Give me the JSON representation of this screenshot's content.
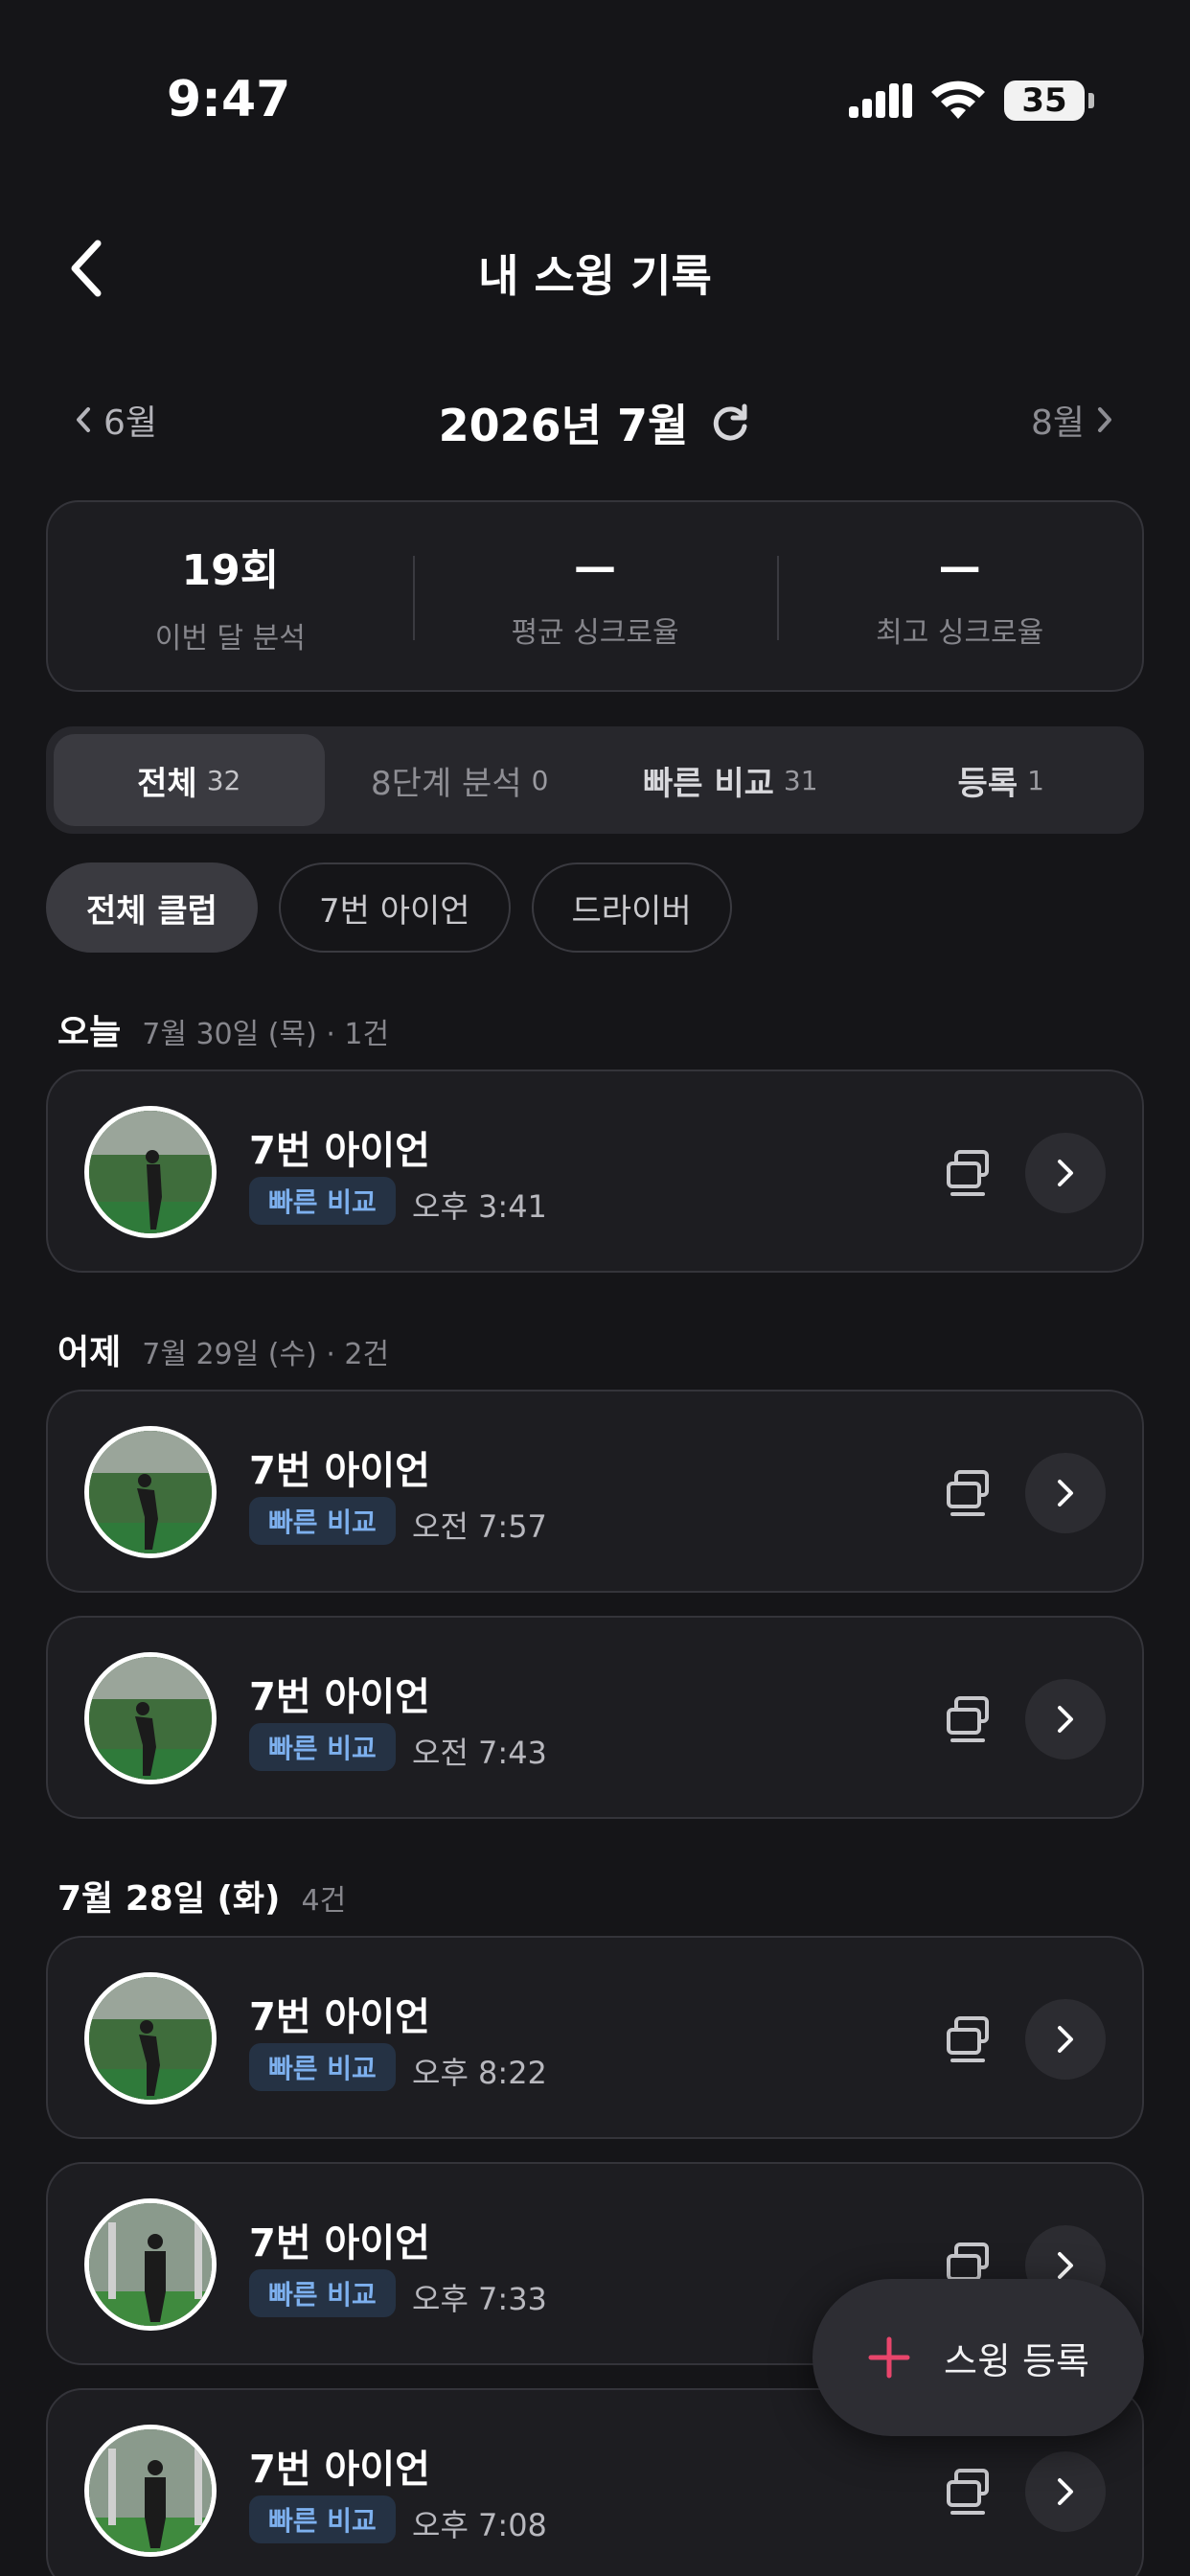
{
  "status_bar": {
    "time": "9:47",
    "battery": "35"
  },
  "header": {
    "title": "내 스윙 기록"
  },
  "month_nav": {
    "prev": "6월",
    "current": "2026년 7월",
    "next": "8월"
  },
  "stats": [
    {
      "value": "19회",
      "label": "이번 달 분석"
    },
    {
      "value": "—",
      "label": "평균 싱크로율"
    },
    {
      "value": "—",
      "label": "최고 싱크로율"
    }
  ],
  "tabs": [
    {
      "label": "전체",
      "count": "32"
    },
    {
      "label": "8단계 분석",
      "count": "0"
    },
    {
      "label": "빠른 비교",
      "count": "31"
    },
    {
      "label": "등록",
      "count": "1"
    }
  ],
  "chips": [
    "전체 클럽",
    "7번 아이언",
    "드라이버"
  ],
  "groups": [
    {
      "title": "오늘",
      "sub": "7월 30일 (목) · 1건"
    },
    {
      "title": "어제",
      "sub": "7월 29일 (수) · 2건"
    },
    {
      "title": "7월 28일 (화)",
      "sub": "4건"
    }
  ],
  "records": [
    {
      "title": "7번 아이언",
      "badge": "빠른 비교",
      "time": "오후 3:41"
    },
    {
      "title": "7번 아이언",
      "badge": "빠른 비교",
      "time": "오전 7:57"
    },
    {
      "title": "7번 아이언",
      "badge": "빠른 비교",
      "time": "오전 7:43"
    },
    {
      "title": "7번 아이언",
      "badge": "빠른 비교",
      "time": "오후 8:22"
    },
    {
      "title": "7번 아이언",
      "badge": "빠른 비교",
      "time": "오후 7:33"
    },
    {
      "title": "7번 아이언",
      "badge": "빠른 비교",
      "time": "오후 7:08"
    }
  ],
  "fab": {
    "label": "스윙 등록"
  },
  "colors": {
    "background": "#151518",
    "card": "#1D1D21",
    "badge_text": "#7DB0EE",
    "fab_plus": "#E8456B"
  }
}
